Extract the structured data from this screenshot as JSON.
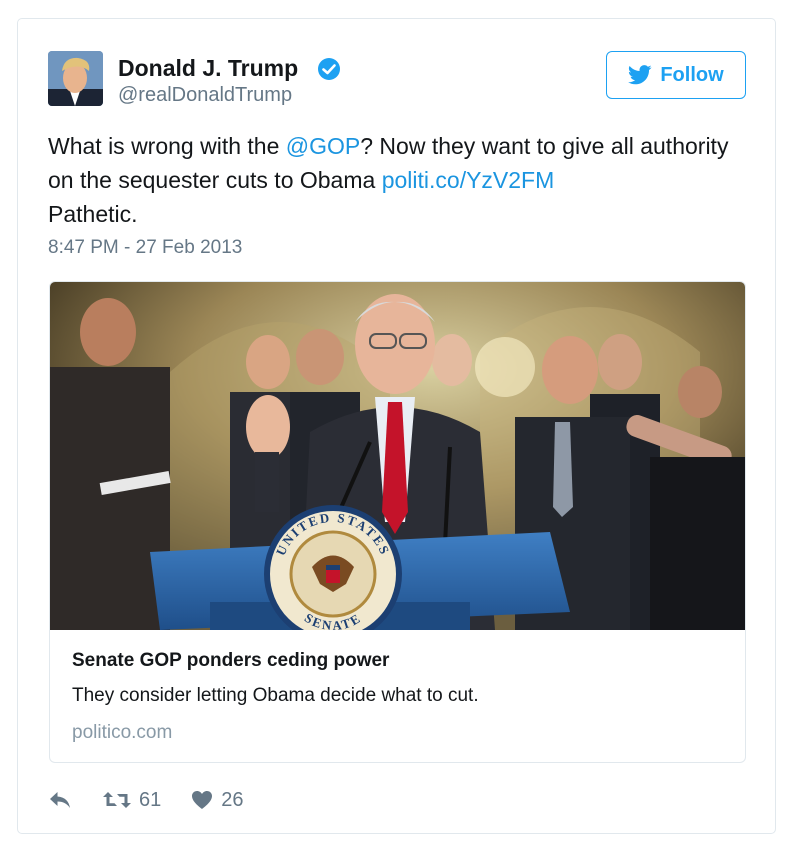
{
  "user": {
    "name": "Donald J. Trump",
    "handle": "@realDonaldTrump",
    "verified": true
  },
  "follow_button": {
    "label": "Follow",
    "icon": "twitter-bird-icon"
  },
  "tweet": {
    "text_part1": "What is wrong with the ",
    "mention": "@GOP",
    "text_part2": "? Now they want to give all authority on the sequester cuts to Obama ",
    "link": "politi.co/YzV2FM",
    "text_part3": " Pathetic.",
    "timestamp": "8:47 PM - 27 Feb 2013"
  },
  "link_card": {
    "headline": "Senate GOP ponders ceding power",
    "description": "They consider letting Obama decide what to cut.",
    "domain": "politico.com"
  },
  "seal": {
    "top_text": "UNITED STATES",
    "bottom_text": "SENATE"
  },
  "actions": {
    "reply_icon": "reply-icon",
    "retweet_icon": "retweet-icon",
    "retweet_count": "61",
    "like_icon": "heart-icon",
    "like_count": "26"
  },
  "colors": {
    "accent": "#1da1f2",
    "link": "#1b95e0",
    "muted": "#657786",
    "border": "#e1e8ed"
  }
}
